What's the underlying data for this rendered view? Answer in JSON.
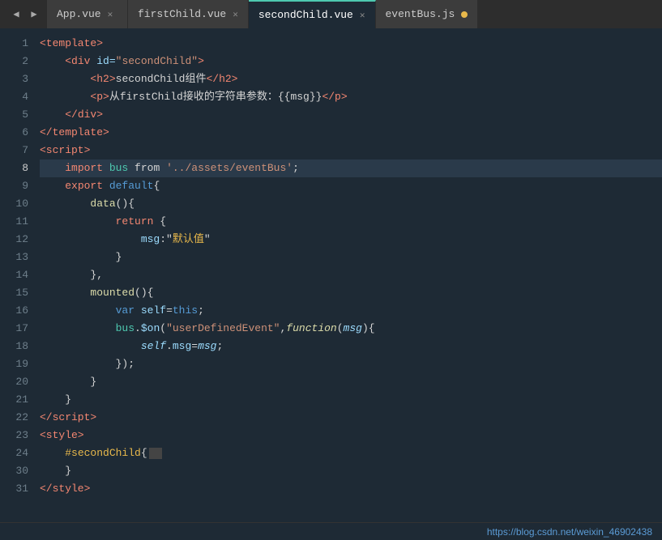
{
  "tabs": [
    {
      "name": "App.vue",
      "active": false,
      "has_close": true,
      "has_dot": false
    },
    {
      "name": "firstChild.vue",
      "active": false,
      "has_close": true,
      "has_dot": false
    },
    {
      "name": "secondChild.vue",
      "active": true,
      "has_close": false,
      "has_dot": false
    },
    {
      "name": "eventBus.js",
      "active": false,
      "has_close": false,
      "has_dot": true
    }
  ],
  "lines": [
    {
      "num": 1,
      "active": false
    },
    {
      "num": 2,
      "active": false
    },
    {
      "num": 3,
      "active": false
    },
    {
      "num": 4,
      "active": false
    },
    {
      "num": 5,
      "active": false
    },
    {
      "num": 6,
      "active": false
    },
    {
      "num": 7,
      "active": false
    },
    {
      "num": 8,
      "active": true
    },
    {
      "num": 9,
      "active": false
    },
    {
      "num": 10,
      "active": false
    },
    {
      "num": 11,
      "active": false
    },
    {
      "num": 12,
      "active": false
    },
    {
      "num": 13,
      "active": false
    },
    {
      "num": 14,
      "active": false
    },
    {
      "num": 15,
      "active": false
    },
    {
      "num": 16,
      "active": false
    },
    {
      "num": 17,
      "active": false
    },
    {
      "num": 18,
      "active": false
    },
    {
      "num": 19,
      "active": false
    },
    {
      "num": 20,
      "active": false
    },
    {
      "num": 21,
      "active": false
    },
    {
      "num": 22,
      "active": false
    },
    {
      "num": 23,
      "active": false
    },
    {
      "num": 24,
      "active": false
    },
    {
      "num": 30,
      "active": false
    },
    {
      "num": 31,
      "active": false
    }
  ],
  "status_url": "https://blog.csdn.net/weixin_46902438"
}
